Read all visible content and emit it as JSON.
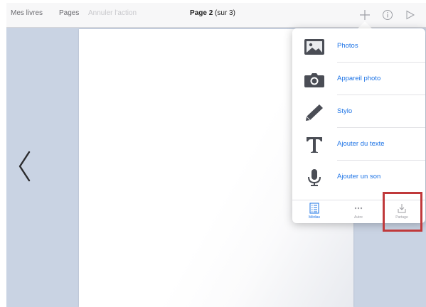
{
  "toolbar": {
    "my_books": "Mes livres",
    "pages": "Pages",
    "undo": "Annuler l'action",
    "title_bold": "Page 2",
    "title_rest": " (sur 3)"
  },
  "menu": {
    "items": [
      {
        "label": "Photos",
        "icon": "photos-icon"
      },
      {
        "label": "Appareil photo",
        "icon": "camera-icon"
      },
      {
        "label": "Stylo",
        "icon": "pen-icon"
      },
      {
        "label": "Ajouter du texte",
        "icon": "text-icon"
      },
      {
        "label": "Ajouter un son",
        "icon": "microphone-icon"
      }
    ],
    "tabs": [
      {
        "label": "Médias",
        "icon": "media-list-icon",
        "active": true
      },
      {
        "label": "Autre",
        "icon": "more-icon",
        "active": false
      },
      {
        "label": "Partage",
        "icon": "share-icon",
        "active": false
      }
    ]
  },
  "colors": {
    "accent": "#1e74e6",
    "background": "#c9d3e3",
    "highlight": "#c0393b"
  }
}
